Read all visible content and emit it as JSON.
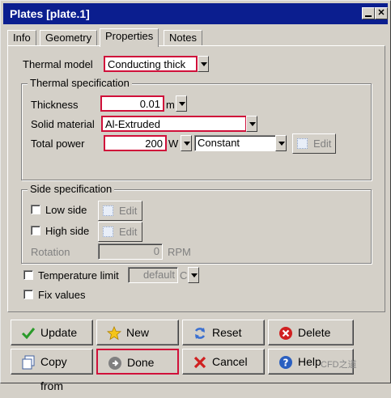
{
  "window": {
    "title": "Plates [plate.1]"
  },
  "tabs": [
    "Info",
    "Geometry",
    "Properties",
    "Notes"
  ],
  "thermal_model": {
    "label": "Thermal model",
    "value": "Conducting thick"
  },
  "thermal_spec": {
    "title": "Thermal specification",
    "thickness": {
      "label": "Thickness",
      "value": "0.01",
      "unit": "m"
    },
    "solid_material": {
      "label": "Solid material",
      "value": "Al-Extruded"
    },
    "total_power": {
      "label": "Total power",
      "value": "200",
      "unit": "W",
      "mode": "Constant",
      "edit": "Edit"
    }
  },
  "side_spec": {
    "title": "Side specification",
    "low_side": {
      "label": "Low side",
      "edit": "Edit"
    },
    "high_side": {
      "label": "High side",
      "edit": "Edit"
    },
    "rotation": {
      "label": "Rotation",
      "value": "0",
      "unit": "RPM"
    }
  },
  "temp_limit": {
    "label": "Temperature limit",
    "value": "default",
    "unit": "C"
  },
  "fix_values": {
    "label": "Fix values"
  },
  "buttons": {
    "update": "Update",
    "new": "New",
    "reset": "Reset",
    "delete": "Delete",
    "copy_from": "Copy from",
    "done": "Done",
    "cancel": "Cancel",
    "help": "Help"
  },
  "watermark": "CFD之道",
  "colors": {
    "titlebar": "#0b1e8f",
    "highlight": "#d0103a",
    "face": "#d4d0c8"
  }
}
